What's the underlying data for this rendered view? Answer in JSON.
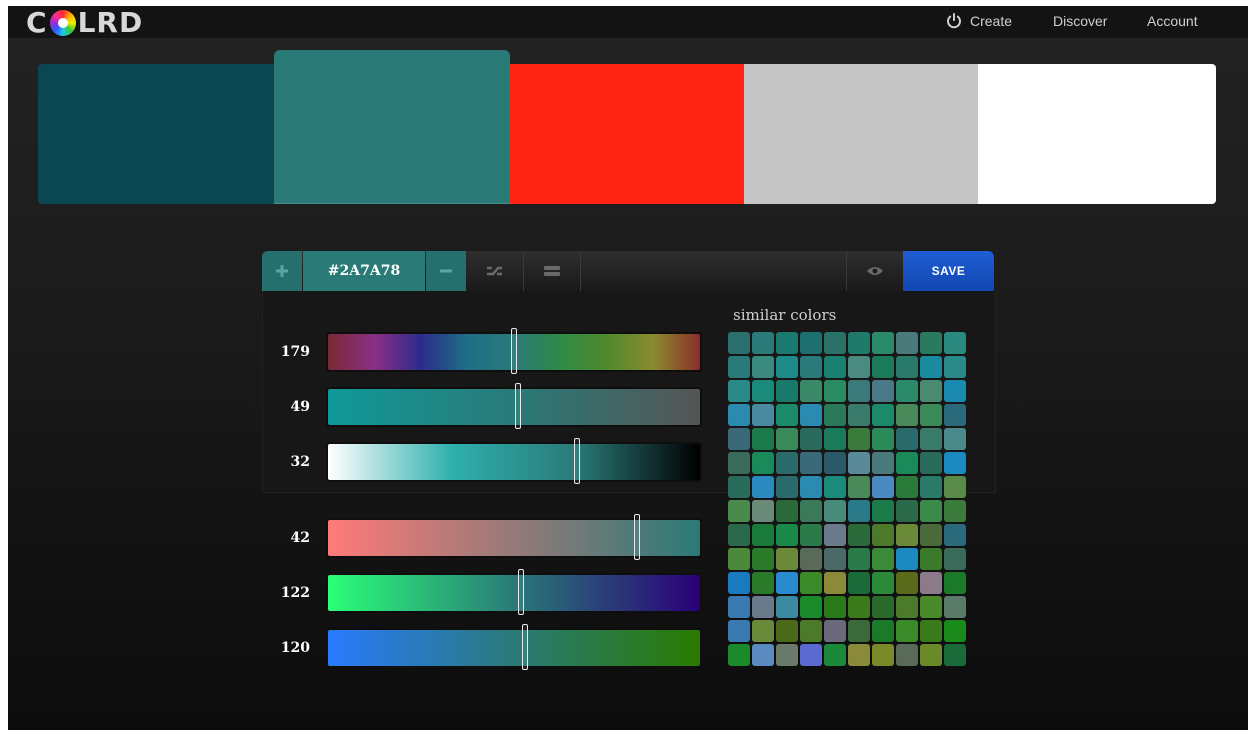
{
  "app": {
    "logo_text_left": "C",
    "logo_text_right": "LRD"
  },
  "nav": {
    "create": "Create",
    "discover": "Discover",
    "account": "Account"
  },
  "palette": {
    "swatches": [
      "#0b4752",
      "#2a7a78",
      "#ff2414",
      "#c6c6c6",
      "#ffffff"
    ],
    "selected_index": 1
  },
  "toolbar": {
    "hex": "#2A7A78",
    "save_label": "SAVE",
    "icons": [
      "plus-icon",
      "minus-icon",
      "shuffle-icon",
      "swap-icon",
      "eye-icon"
    ]
  },
  "sliders_hsl": [
    {
      "value": "179",
      "level": 0.5,
      "gradient": "linear-gradient(90deg,#7a2a33,#8a2f86,#2b2c8a,#1f6f86,#2a7a78,#2f8a45,#4f8a2e,#8a8a2e,#8a2f2a)"
    },
    {
      "value": "49",
      "level": 0.51,
      "gradient": "linear-gradient(90deg,#0f9999,#2a7a78,#555555)"
    },
    {
      "value": "32",
      "level": 0.67,
      "gradient": "linear-gradient(90deg,#ffffff,#2eb0ad,#2a7a78,#000000)"
    }
  ],
  "sliders_rgb": [
    {
      "value": "42",
      "level": 0.83,
      "gradient": "linear-gradient(90deg,#ff7a78,#2a7a78)"
    },
    {
      "value": "122",
      "level": 0.52,
      "gradient": "linear-gradient(90deg,#2aff78,#2a7a78,#2a0078)"
    },
    {
      "value": "120",
      "level": 0.53,
      "gradient": "linear-gradient(90deg,#2a7aff,#2a7a78,#2a7a00)"
    }
  ],
  "similar": {
    "title": "similar colors",
    "colors": [
      "#2a6e6e",
      "#2a7a7a",
      "#1a7a70",
      "#1e7070",
      "#2a7268",
      "#1f7a6a",
      "#2a8a6a",
      "#4a7a7a",
      "#2a7a60",
      "#2a8a80",
      "#2a7a7a",
      "#3a8a80",
      "#1f8a8a",
      "#2a7a7a",
      "#1a8070",
      "#4a8a80",
      "#1a7a5a",
      "#2a7a6a",
      "#1a8aa0",
      "#2a8a8a",
      "#2a8a8a",
      "#1a8a7a",
      "#1a7a6a",
      "#3a8a6a",
      "#2a8a60",
      "#3a7a7a",
      "#4a7a8a",
      "#2a8a6a",
      "#4a8a70",
      "#1a8ab0",
      "#2a8ab0",
      "#4a8aa0",
      "#1a8a6a",
      "#2a8ab0",
      "#2a7a5a",
      "#3a7a6a",
      "#1a8a6a",
      "#4a8a5a",
      "#3a8a5a",
      "#2a6a7a",
      "#3a6a7a",
      "#1a7a4a",
      "#3a8a5a",
      "#2a6a5a",
      "#1a7a5a",
      "#3a7a3a",
      "#2a8a5a",
      "#2a6a6a",
      "#3a7a6a",
      "#4a8a8a",
      "#3a6a5a",
      "#1a8a5a",
      "#2a6a6a",
      "#3a6a7a",
      "#2a5a6a",
      "#5a8a9a",
      "#4a7a7a",
      "#1a8a5a",
      "#2a6a5a",
      "#1a8ac0",
      "#2a6a5a",
      "#2a8ac0",
      "#2a6a6a",
      "#2a8ab0",
      "#1a8a7a",
      "#4a8a5a",
      "#4a8ac0",
      "#2a7a3a",
      "#2a7a6a",
      "#5a8a4a",
      "#4a8a4a",
      "#6a8a7a",
      "#2a6a3a",
      "#3a7a5a",
      "#4a8a7a",
      "#2a7a8a",
      "#1a7a4a",
      "#2a6a4a",
      "#3a8a4a",
      "#3a7a3a",
      "#2a6a4a",
      "#1a7a3a",
      "#1a8a4a",
      "#2a7a4a",
      "#6a7a8a",
      "#2a6a3a",
      "#4a7a2a",
      "#6a8a3a",
      "#4a6a3a",
      "#2a6a7a",
      "#4a8a3a",
      "#2a7a2a",
      "#6a8a3a",
      "#5a6a5a",
      "#4a6a6a",
      "#2a7a4a",
      "#3a8a3a",
      "#1a8ac0",
      "#3a7a2a",
      "#3a6a5a",
      "#1a7ac0",
      "#2a7a2a",
      "#2a8ad0",
      "#3a8a2a",
      "#8a8a3a",
      "#1a6a3a",
      "#2a8a3a",
      "#5a6a1a",
      "#8a7a8a",
      "#1a7a2a",
      "#3a7ab0",
      "#6a7a8a",
      "#3a8aa0",
      "#1a8a2a",
      "#2a7a1a",
      "#3a7a1a",
      "#2a6a2a",
      "#4a7a2a",
      "#4a8a2a",
      "#5a7a6a",
      "#3a7ab0",
      "#6a8a3a",
      "#4a6a1a",
      "#4a7a2a",
      "#6a6a7a",
      "#3a6a3a",
      "#1a7a2a",
      "#3a8a2a",
      "#3a7a1a",
      "#1a8a1a",
      "#1a8a2a",
      "#5a8ac0",
      "#6a7a6a",
      "#5a6ad0",
      "#1a8a3a",
      "#8a8a3a",
      "#7a8a2a",
      "#5a6a5a",
      "#6a8a2a",
      "#1a6a3a"
    ]
  }
}
